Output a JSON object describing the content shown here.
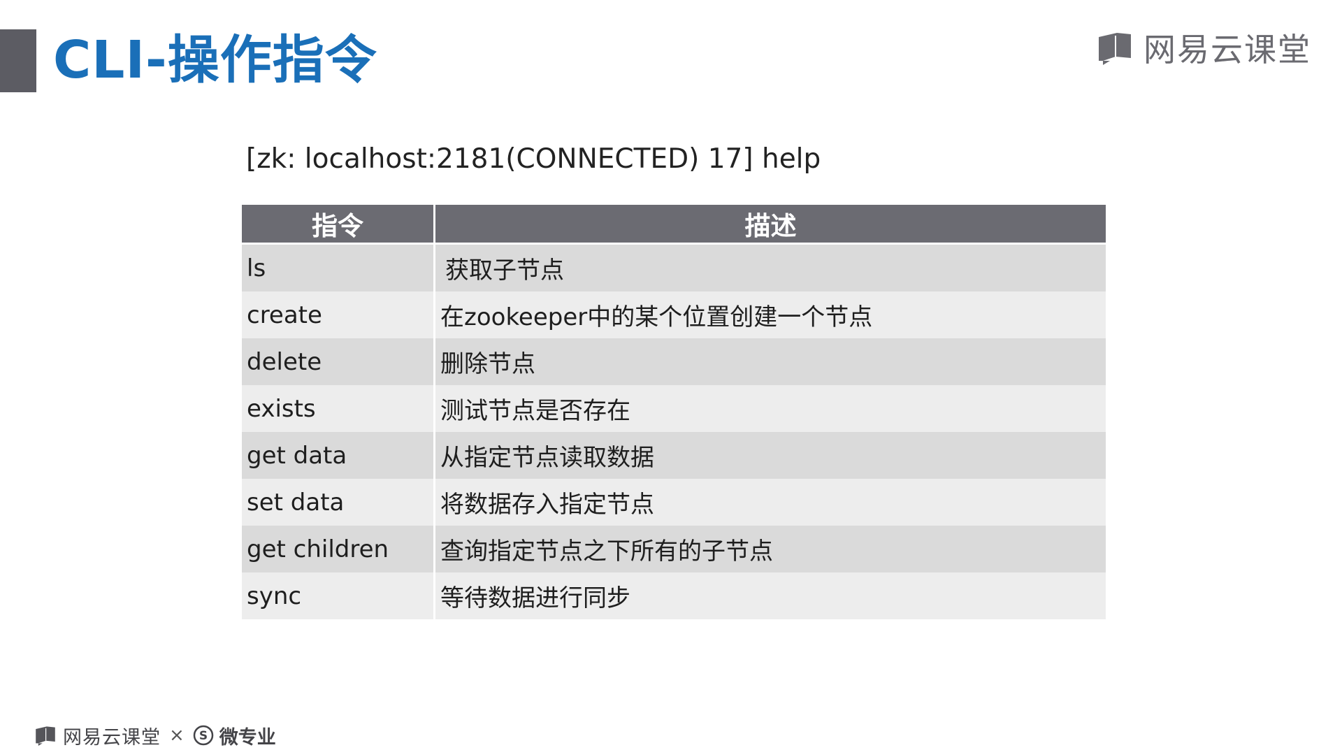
{
  "slide": {
    "title": "CLI-操作指令"
  },
  "brand_top": {
    "text": "网易云课堂",
    "icon": "book-icon"
  },
  "command_line": "[zk: localhost:2181(CONNECTED) 17] help",
  "table": {
    "headers": [
      "指令",
      "描述"
    ],
    "rows": [
      {
        "command": "ls",
        "description": "获取子节点"
      },
      {
        "command": "create",
        "description": "在zookeeper中的某个位置创建一个节点"
      },
      {
        "command": "delete",
        "description": "删除节点"
      },
      {
        "command": "exists",
        "description": "测试节点是否存在"
      },
      {
        "command": "get data",
        "description": "从指定节点读取数据"
      },
      {
        "command": "set data",
        "description": "将数据存入指定节点"
      },
      {
        "command": "get children",
        "description": "查询指定节点之下所有的子节点"
      },
      {
        "command": "sync",
        "description": "等待数据进行同步"
      }
    ]
  },
  "brand_bottom": {
    "left_text": "网易云课堂",
    "separator": "×",
    "right_text": "微专业",
    "icons": [
      "book-icon",
      "s-circle-icon"
    ]
  },
  "colors": {
    "title_blue": "#1a6fb8",
    "header_gray": "#6b6b72",
    "row_dark": "#dadada",
    "row_light": "#ededed",
    "accent_bar": "#5c5c63"
  }
}
